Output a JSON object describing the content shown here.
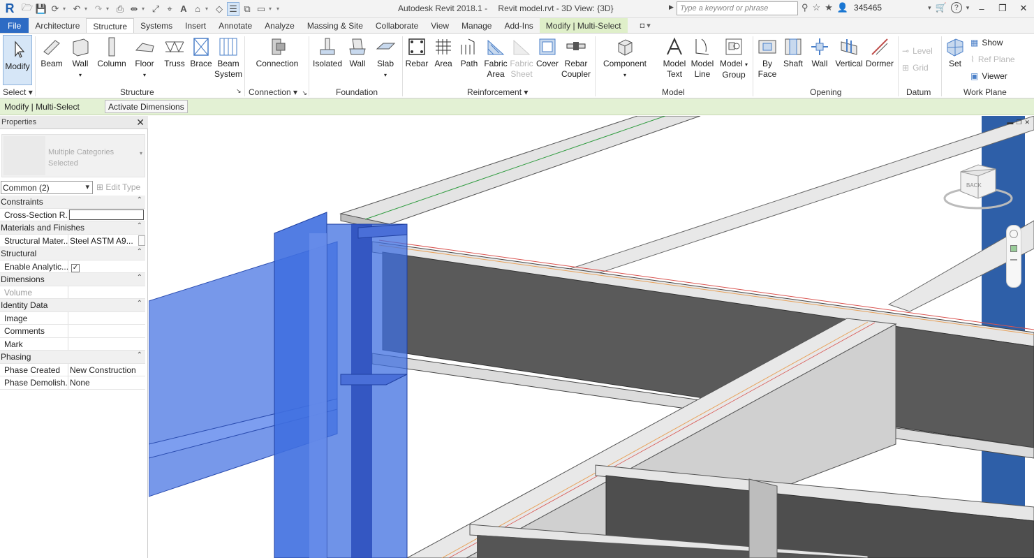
{
  "titlebar": {
    "app": "Autodesk Revit 2018.1 -",
    "file": "Revit model.rvt - 3D View: {3D}",
    "search_placeholder": "Type a keyword or phrase",
    "user": "345465"
  },
  "tabs": [
    "File",
    "Architecture",
    "Structure",
    "Systems",
    "Insert",
    "Annotate",
    "Analyze",
    "Massing & Site",
    "Collaborate",
    "View",
    "Manage",
    "Add-Ins",
    "Modify | Multi-Select"
  ],
  "ribbon": {
    "select": {
      "modify": "Modify",
      "label": "Select"
    },
    "structure": {
      "beam": "Beam",
      "wall": "Wall",
      "column": "Column",
      "floor": "Floor",
      "truss": "Truss",
      "brace": "Brace",
      "beam_system_1": "Beam",
      "beam_system_2": "System",
      "label": "Structure"
    },
    "connection": {
      "connection": "Connection",
      "label": "Connection"
    },
    "foundation": {
      "isolated": "Isolated",
      "wall": "Wall",
      "slab": "Slab",
      "label": "Foundation"
    },
    "reinforcement": {
      "rebar": "Rebar",
      "area": "Area",
      "path": "Path",
      "fabric_area_1": "Fabric",
      "fabric_area_2": "Area",
      "fabric_sheet_1": "Fabric",
      "fabric_sheet_2": "Sheet",
      "cover": "Cover",
      "rebar_coupler_1": "Rebar",
      "rebar_coupler_2": "Coupler",
      "label": "Reinforcement"
    },
    "model": {
      "component": "Component",
      "model_text_1": "Model",
      "model_text_2": "Text",
      "model_line_1": "Model",
      "model_line_2": "Line",
      "model_group_1": "Model",
      "model_group_2": "Group",
      "label": "Model"
    },
    "opening": {
      "by_face_1": "By",
      "by_face_2": "Face",
      "shaft": "Shaft",
      "wall": "Wall",
      "vertical": "Vertical",
      "dormer": "Dormer",
      "label": "Opening"
    },
    "datum": {
      "level": "Level",
      "grid": "Grid",
      "label": "Datum"
    },
    "work_plane": {
      "set": "Set",
      "show": "Show",
      "ref_plane": "Ref  Plane",
      "viewer": "Viewer",
      "label": "Work Plane"
    }
  },
  "context_bar": {
    "label": "Modify | Multi-Select",
    "button": "Activate Dimensions"
  },
  "properties": {
    "title": "Properties",
    "type_name": "Multiple Categories Selected",
    "filter": "Common (2)",
    "edit_type": "Edit Type",
    "groups": [
      {
        "name": "Constraints",
        "rows": [
          {
            "name": "Cross-Section R...",
            "value": ""
          }
        ]
      },
      {
        "name": "Materials and Finishes",
        "rows": [
          {
            "name": "Structural Mater...",
            "value": "Steel ASTM A9..."
          }
        ]
      },
      {
        "name": "Structural",
        "rows": [
          {
            "name": "Enable Analytic...",
            "value": "✓"
          }
        ]
      },
      {
        "name": "Dimensions",
        "rows": [
          {
            "name": "Volume",
            "value": ""
          }
        ]
      },
      {
        "name": "Identity Data",
        "rows": [
          {
            "name": "Image",
            "value": ""
          },
          {
            "name": "Comments",
            "value": ""
          },
          {
            "name": "Mark",
            "value": ""
          }
        ]
      },
      {
        "name": "Phasing",
        "rows": [
          {
            "name": "Phase Created",
            "value": "New Construction"
          },
          {
            "name": "Phase Demolish...",
            "value": "None"
          }
        ]
      }
    ]
  },
  "viewcube": {
    "face": "BACK"
  },
  "colors": {
    "file_tab": "#2d6bc4",
    "contextual": "#dfefc9",
    "context_bar": "#e3f1d4",
    "selection_blue": "#3f6fe0"
  }
}
